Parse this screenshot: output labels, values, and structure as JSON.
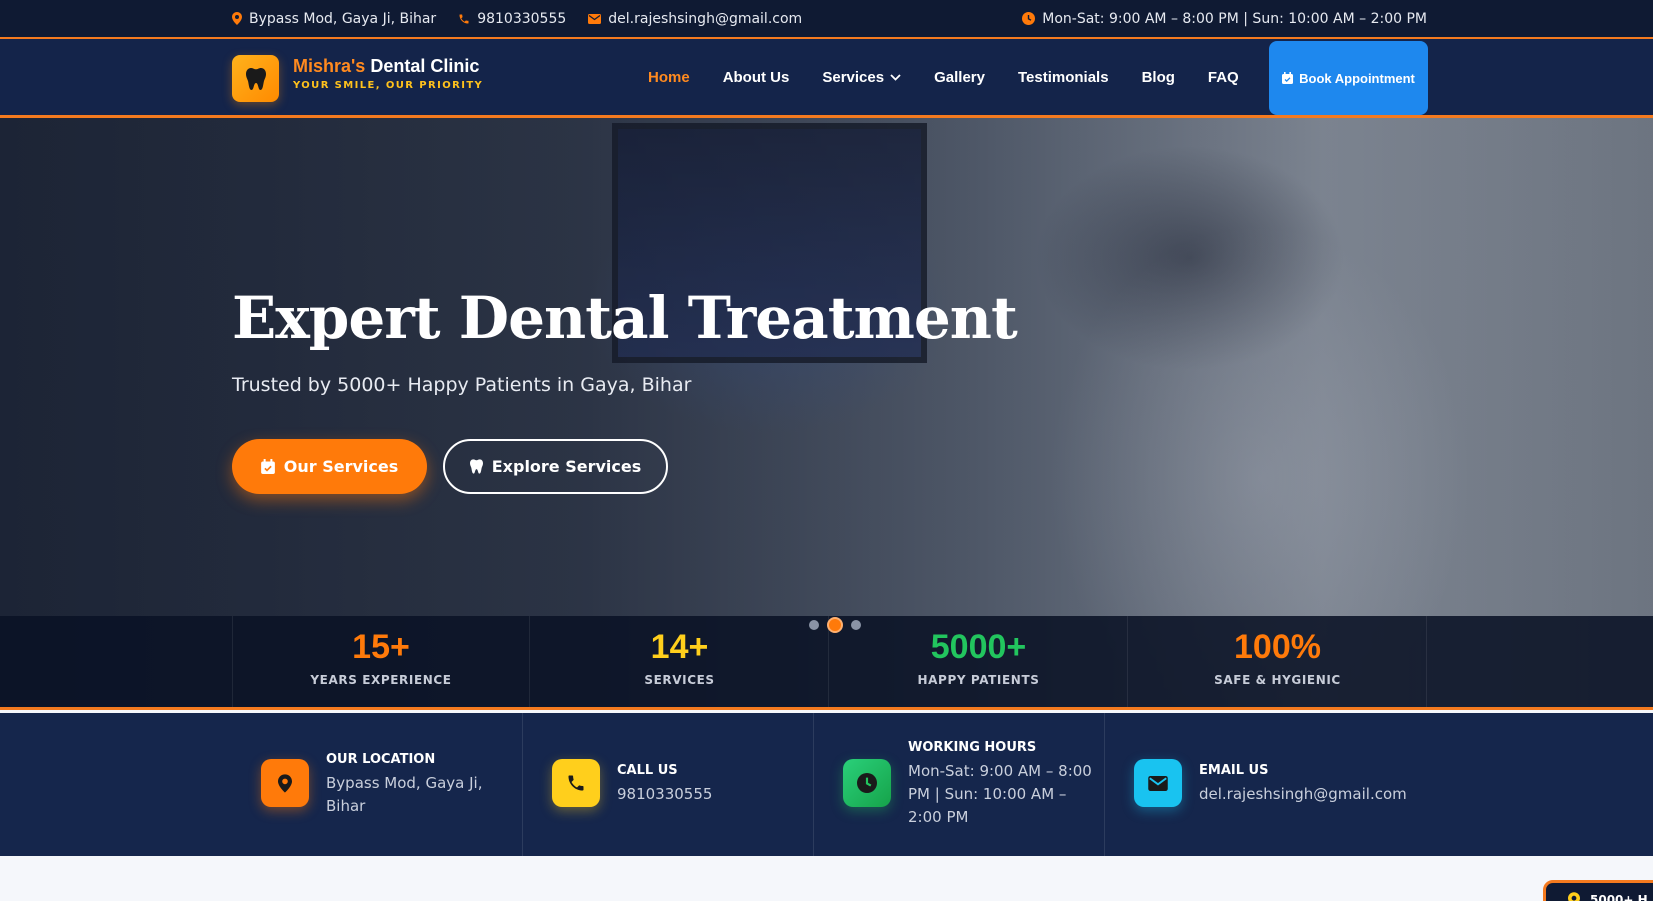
{
  "topbar": {
    "address": "Bypass Mod, Gaya Ji, Bihar",
    "phone": "9810330555",
    "email": "del.rajeshsingh@gmail.com",
    "hours": "Mon-Sat: 9:00 AM – 8:00 PM | Sun: 10:00 AM – 2:00 PM"
  },
  "brand": {
    "name_accent": "Mishra's",
    "name_rest": " Dental Clinic",
    "tagline": "YOUR SMILE, OUR PRIORITY"
  },
  "nav": {
    "items": [
      "Home",
      "About Us",
      "Services",
      "Gallery",
      "Testimonials",
      "Blog",
      "FAQ"
    ],
    "active": "Home",
    "cta": "Book Appointment"
  },
  "hero": {
    "title": "Expert Dental Treatment",
    "subtitle": "Trusted by 5000+ Happy Patients in Gaya, Bihar",
    "primary_button": "Our Services",
    "secondary_button": "Explore Services"
  },
  "stats": [
    {
      "value": "15+",
      "label": "YEARS EXPERIENCE",
      "color": "#ff7a0a"
    },
    {
      "value": "14+",
      "label": "SERVICES",
      "color": "#ffcf1c"
    },
    {
      "value": "5000+",
      "label": "HAPPY PATIENTS",
      "color": "#22c55e"
    },
    {
      "value": "100%",
      "label": "SAFE & HYGIENIC",
      "color": "#ff7a0a"
    }
  ],
  "carousel": {
    "slides": 3,
    "active_index": 1
  },
  "info": [
    {
      "title": "OUR LOCATION",
      "value": "Bypass Mod, Gaya Ji, Bihar",
      "icon": "location-pin-icon",
      "color": "#ff7a0a"
    },
    {
      "title": "CALL US",
      "value": "9810330555",
      "icon": "phone-icon",
      "color": "#ffcf1c"
    },
    {
      "title": "WORKING HOURS",
      "value": "Mon-Sat: 9:00 AM – 8:00 PM | Sun: 10:00 AM – 2:00 PM",
      "icon": "clock-icon",
      "color": "#22c55e"
    },
    {
      "title": "EMAIL US",
      "value": "del.rajeshsingh@gmail.com",
      "icon": "envelope-icon",
      "color": "#19c3f0"
    }
  ],
  "floating_chip": {
    "label": "5000+ H"
  },
  "colors": {
    "accent": "#ff7a0a",
    "navy": "#14244a",
    "cta_blue": "#1e88ee"
  }
}
